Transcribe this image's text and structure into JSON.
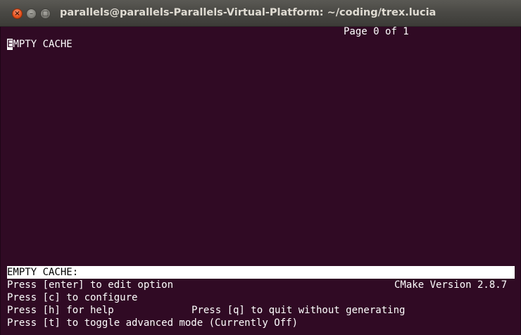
{
  "window": {
    "title": "parallels@parallels-Parallels-Virtual-Platform: ~/coding/trex.lucia",
    "close_glyph": "×",
    "minimize_glyph": "–",
    "maximize_glyph": "□",
    "accent_color": "#e9541f",
    "terminal_bg": "#300a24"
  },
  "cmake": {
    "page_indicator": "Page 0 of 1",
    "entry_cursor_char": "E",
    "entry_rest": "MPTY CACHE",
    "status_label": "EMPTY CACHE:",
    "help_enter": "Press [enter] to edit option",
    "version": "CMake Version 2.8.7",
    "help_configure": "Press [c] to configure",
    "help_h": "Press [h] for help",
    "help_quit": "Press [q] to quit without generating",
    "help_toggle": "Press [t] to toggle advanced mode (Currently Off)"
  }
}
